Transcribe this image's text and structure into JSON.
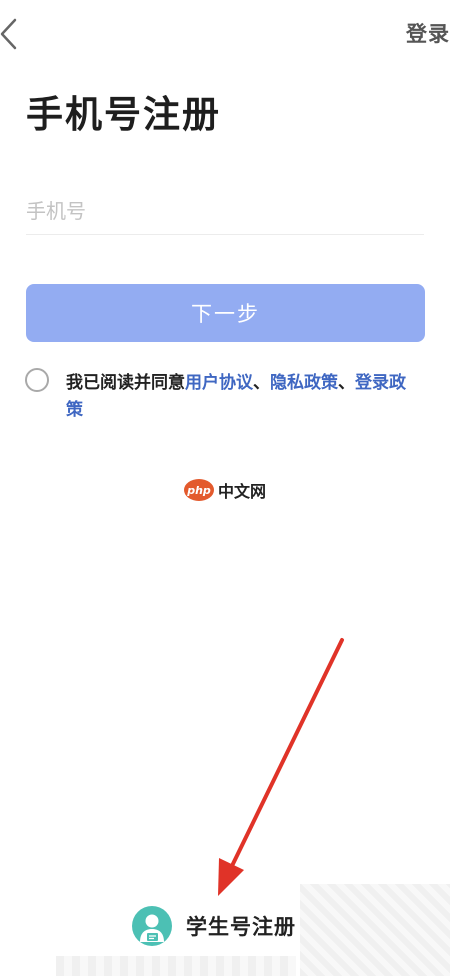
{
  "header": {
    "back_icon": "chevron-left-icon",
    "login_label": "登录"
  },
  "page": {
    "title": "手机号注册"
  },
  "form": {
    "phone_placeholder": "手机号",
    "phone_value": "",
    "next_label": "下一步",
    "next_button_color": "#93acf2"
  },
  "agreement": {
    "checked": false,
    "prefix": "我已阅读并同意",
    "user_agreement": "用户协议",
    "sep1": "、",
    "privacy_policy": "隐私政策",
    "sep2": "、",
    "login_policy": "登录政策",
    "link_color": "#3f67c2"
  },
  "watermark": {
    "logo": "php",
    "text": "中文网"
  },
  "footer": {
    "student_icon": "student-avatar-icon",
    "student_register_label": "学生号注册",
    "accent_color": "#4cc0b4"
  },
  "annotation": {
    "arrow_color": "#e03328"
  }
}
